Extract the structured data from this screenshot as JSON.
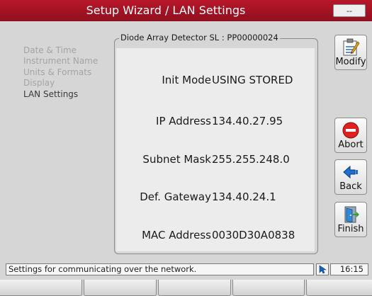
{
  "title": "Setup Wizard / LAN Settings",
  "title_button": "--",
  "nav": {
    "items": [
      {
        "label": "Date & Time",
        "active": false
      },
      {
        "label": "Instrument Name",
        "active": false
      },
      {
        "label": "Units & Formats",
        "active": false
      },
      {
        "label": "Display",
        "active": false
      },
      {
        "label": "LAN Settings",
        "active": true
      }
    ]
  },
  "group": {
    "title": "Diode Array Detector SL : PP00000024",
    "rows": [
      {
        "label": "Init Mode",
        "value": "USING STORED"
      },
      {
        "label": "IP Address",
        "value": "134.40.27.95"
      },
      {
        "label": "Subnet Mask",
        "value": "255.255.248.0"
      },
      {
        "label": "Def. Gateway",
        "value": "134.40.24.1"
      },
      {
        "label": "MAC Address",
        "value": "0030D30A0838"
      }
    ]
  },
  "buttons": {
    "modify": "Modify",
    "abort": "Abort",
    "back": "Back",
    "finish": "Finish"
  },
  "status": {
    "text": "Settings for communicating over the network.",
    "time": "16:15"
  },
  "colors": {
    "title_bar": "#a3142a",
    "background": "#d6d6d6",
    "panel": "#ececec",
    "accent_blue": "#1565c0",
    "abort_red": "#e02020"
  },
  "icons": {
    "modify": "clipboard-edit-icon",
    "abort": "stop-icon",
    "back": "arrow-left-icon",
    "finish": "door-exit-icon",
    "status": "cursor-icon"
  }
}
